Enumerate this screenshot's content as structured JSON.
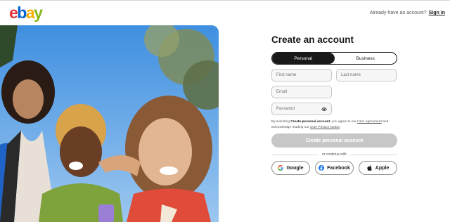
{
  "header": {
    "logo_letters": [
      "e",
      "b",
      "a",
      "y"
    ],
    "prompt": "Already have an account?",
    "signin_link": "Sign in"
  },
  "form": {
    "title": "Create an account",
    "tabs": [
      {
        "label": "Personal",
        "active": true
      },
      {
        "label": "Business",
        "active": false
      }
    ],
    "fields": {
      "first_name": "First name",
      "last_name": "Last name",
      "email": "Email",
      "password": "Password"
    },
    "legal": {
      "prefix": "By selecting ",
      "bold": "Create personal account",
      "middle": ", you agree to our ",
      "link1": "User Agreement",
      "middle2": " and acknowledge reading our ",
      "link2": "User Privacy Notice",
      "suffix": "."
    },
    "create_button": "Create personal account",
    "divider_text": "or continue with",
    "social": [
      {
        "label": "Google",
        "icon": "google-icon"
      },
      {
        "label": "Facebook",
        "icon": "facebook-icon"
      },
      {
        "label": "Apple",
        "icon": "apple-icon"
      }
    ]
  },
  "colors": {
    "brand_red": "#e53238",
    "brand_blue": "#0064d2",
    "brand_yellow": "#f5af02",
    "brand_green": "#86b817",
    "disabled_button": "#c7c7c7"
  }
}
